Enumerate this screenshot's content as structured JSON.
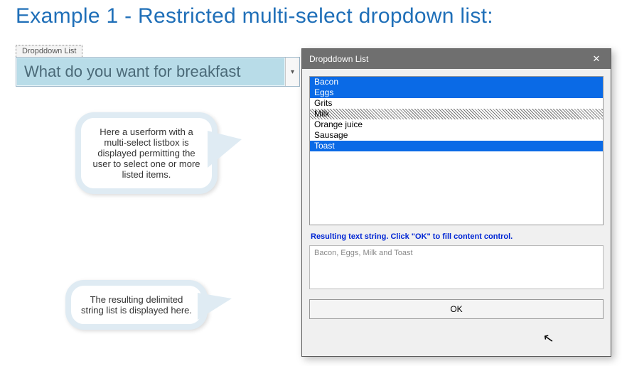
{
  "heading": "Example 1 - Restricted multi-select dropdown list:",
  "content_control": {
    "tab_label": "Dropddown List",
    "field_text": "What do you want for breakfast"
  },
  "callouts": {
    "c1": "Here a userform with a multi-select listbox is displayed permitting the user to select one or more listed items.",
    "c2": "The resulting delimited string list is displayed here."
  },
  "dialog": {
    "title": "Dropddown List",
    "listbox": {
      "items": [
        {
          "label": "Bacon",
          "state": "sel"
        },
        {
          "label": "Eggs",
          "state": "sel"
        },
        {
          "label": "Grits",
          "state": ""
        },
        {
          "label": "Milk",
          "state": "dotted"
        },
        {
          "label": "Orange juice",
          "state": ""
        },
        {
          "label": "Sausage",
          "state": ""
        },
        {
          "label": "Toast",
          "state": "sel"
        }
      ]
    },
    "instruction": "Resulting text string. Click \"OK\" to fill content control.",
    "result_text": "Bacon, Eggs, Milk and Toast",
    "ok_label": "OK"
  }
}
